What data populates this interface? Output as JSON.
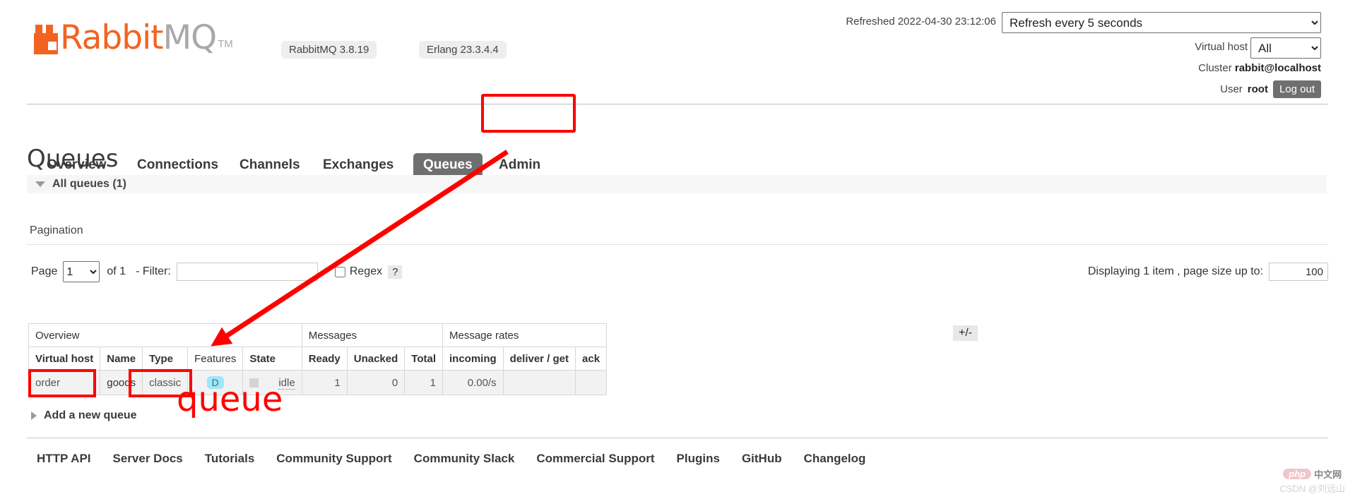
{
  "brand": {
    "name_orange": "Rabbit",
    "name_gray": "MQ",
    "tm": "TM",
    "rabbitmq_version": "RabbitMQ 3.8.19",
    "erlang_version": "Erlang 23.3.4.4"
  },
  "header": {
    "refreshed_label": "Refreshed 2022-04-30 23:12:06",
    "refresh_selected": "Refresh every 5 seconds",
    "refresh_options": [
      "Refresh every 5 seconds"
    ],
    "vhost_label": "Virtual host",
    "vhost_selected": "All",
    "vhost_options": [
      "All"
    ],
    "cluster_label": "Cluster",
    "cluster_value": "rabbit@localhost",
    "user_label": "User",
    "user_value": "root",
    "logout_label": "Log out"
  },
  "nav": {
    "items": [
      {
        "label": "Overview",
        "active": false
      },
      {
        "label": "Connections",
        "active": false
      },
      {
        "label": "Channels",
        "active": false
      },
      {
        "label": "Exchanges",
        "active": false
      },
      {
        "label": "Queues",
        "active": true
      },
      {
        "label": "Admin",
        "active": false
      }
    ]
  },
  "page": {
    "title": "Queues",
    "all_queues_label": "All queues (1)",
    "pagination_heading": "Pagination",
    "add_queue_label": "Add a new queue"
  },
  "pagination": {
    "page_word": "Page",
    "page_selected": "1",
    "page_options": [
      "1"
    ],
    "of_label": "of 1",
    "filter_label": "- Filter:",
    "filter_value": "",
    "filter_placeholder": "",
    "regex_label": "Regex",
    "regex_help": "?",
    "regex_checked": false,
    "displaying_label": "Displaying 1 item , page size up to:",
    "page_size_value": "100"
  },
  "table": {
    "group_headers": [
      {
        "label": "Overview",
        "span": 5
      },
      {
        "label": "Messages",
        "span": 3
      },
      {
        "label": "Message rates",
        "span": 3
      }
    ],
    "columns": [
      {
        "label": "Virtual host",
        "bold": true
      },
      {
        "label": "Name",
        "bold": true
      },
      {
        "label": "Type",
        "bold": true
      },
      {
        "label": "Features",
        "bold": false
      },
      {
        "label": "State",
        "bold": true
      },
      {
        "label": "Ready",
        "bold": true
      },
      {
        "label": "Unacked",
        "bold": true
      },
      {
        "label": "Total",
        "bold": true
      },
      {
        "label": "incoming",
        "bold": true
      },
      {
        "label": "deliver / get",
        "bold": true
      },
      {
        "label": "ack",
        "bold": true
      }
    ],
    "rows": [
      {
        "virtual_host": "order",
        "name": "goods",
        "type": "classic",
        "features": "D",
        "state": "idle",
        "ready": "1",
        "unacked": "0",
        "total": "1",
        "incoming": "0.00/s",
        "deliver_get": "",
        "ack": ""
      }
    ],
    "plusminus_label": "+/-"
  },
  "footer": {
    "links": [
      "HTTP API",
      "Server Docs",
      "Tutorials",
      "Community Support",
      "Community Slack",
      "Commercial Support",
      "Plugins",
      "GitHub",
      "Changelog"
    ]
  },
  "annotations": {
    "queue_text": "queue",
    "accent_color": "#ff0000"
  },
  "watermark": {
    "php": "php",
    "cn": "中文网",
    "credit": "CSDN @刘远山"
  }
}
